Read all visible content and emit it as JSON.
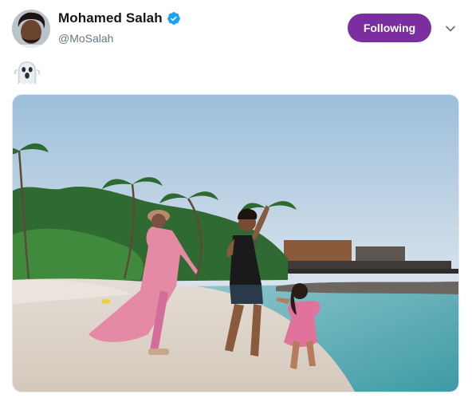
{
  "tweet": {
    "author": {
      "display_name": "Mohamed Salah",
      "handle": "@MoSalah",
      "verified": true,
      "verified_icon": "verified-badge-icon",
      "avatar_icon": "profile-avatar"
    },
    "follow_button": {
      "label": "Following",
      "color": "#7a2ea0"
    },
    "menu_icon": "chevron-down-icon",
    "body": {
      "emoji": "ghost-emoji"
    },
    "media": {
      "type": "photo",
      "scene": "beach-photo"
    }
  },
  "colors": {
    "text_primary": "#14171a",
    "text_secondary": "#657786",
    "verified_blue": "#1da1f2",
    "accent": "#7a2ea0"
  }
}
